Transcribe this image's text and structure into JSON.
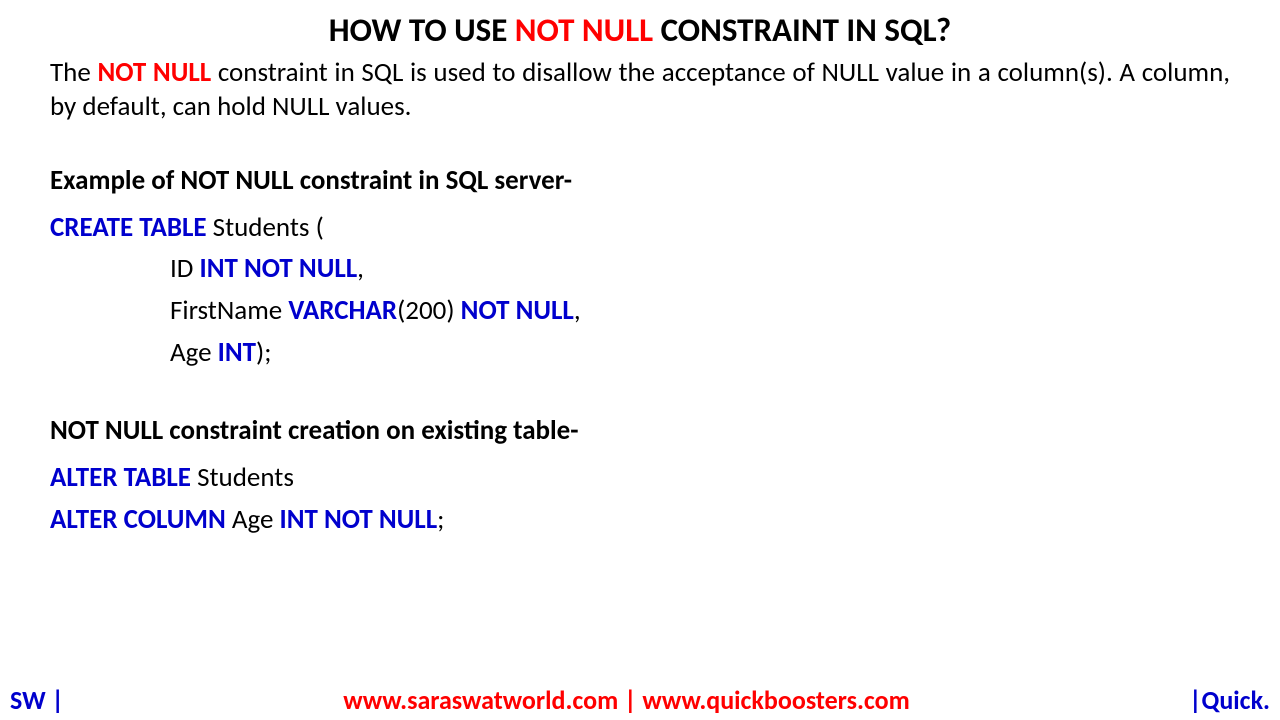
{
  "title": {
    "part1": "HOW TO USE ",
    "highlight": "NOT NULL",
    "part2": " CONSTRAINT IN SQL?"
  },
  "description": {
    "prefix": "The ",
    "highlight": "NOT NULL",
    "rest": " constraint in SQL is used to disallow the acceptance of NULL value in a column(s). A column, by default, can hold NULL values."
  },
  "example1": {
    "heading": "Example of NOT NULL constraint in SQL server-",
    "line1": {
      "kw": "CREATE TABLE",
      "rest": " Students ("
    },
    "line2": {
      "pre": "ID ",
      "kw": "INT NOT NULL",
      "post": ","
    },
    "line3": {
      "pre": "FirstName ",
      "kw1": "VARCHAR",
      "mid": "(200) ",
      "kw2": "NOT NULL",
      "post": ","
    },
    "line4": {
      "pre": "Age ",
      "kw": "INT",
      "post": ");"
    }
  },
  "example2": {
    "heading": "NOT NULL constraint creation on existing table-",
    "line1": {
      "kw": "ALTER TABLE",
      "rest": " Students"
    },
    "line2": {
      "kw1": "ALTER COLUMN",
      "mid": " Age ",
      "kw2": "INT NOT NULL",
      "post": ";"
    }
  },
  "footer": {
    "left": "SW |",
    "center": "www.saraswatworld.com | www.quickboosters.com",
    "right": "|Quick."
  }
}
